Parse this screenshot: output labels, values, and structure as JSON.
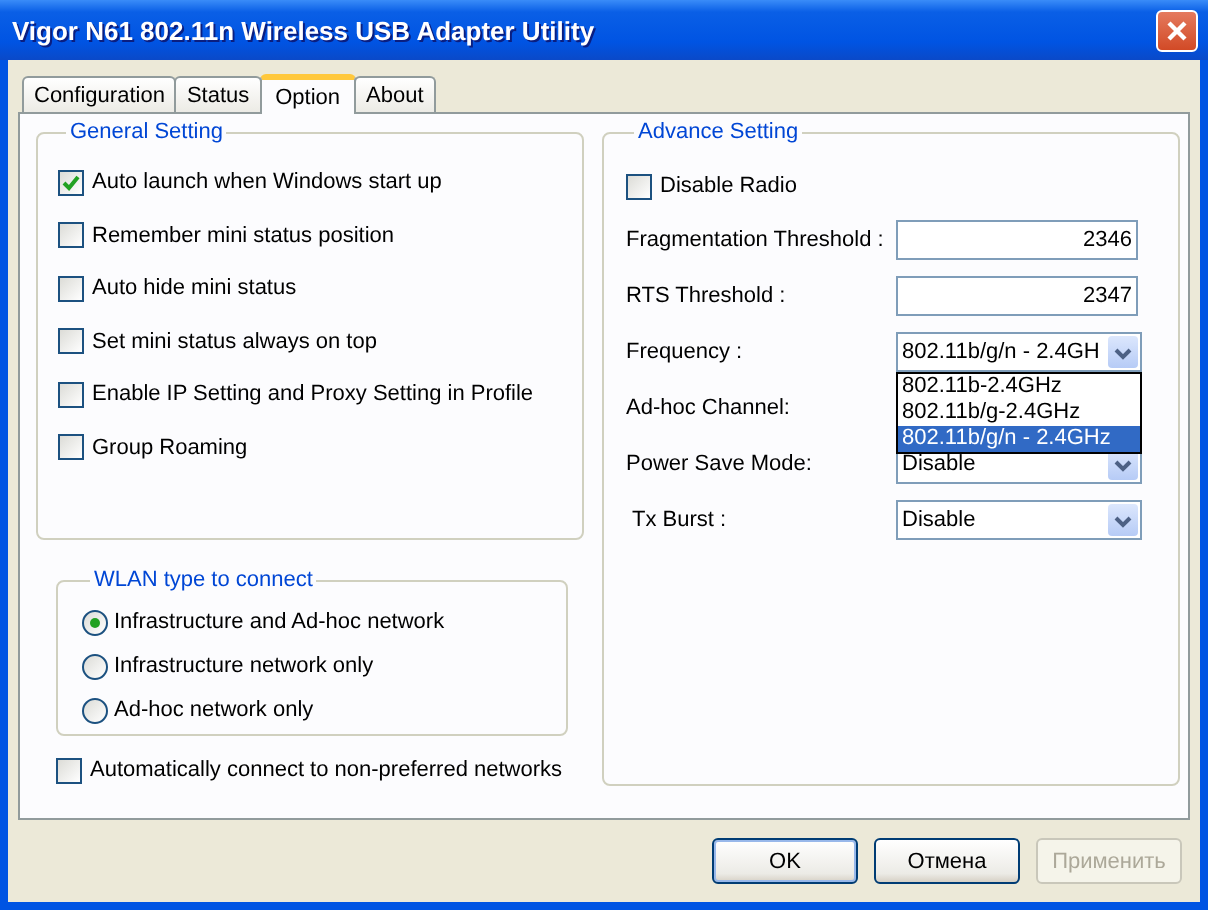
{
  "window": {
    "title": "Vigor N61 802.11n Wireless USB Adapter Utility"
  },
  "tabs": [
    {
      "label": "Configuration",
      "selected": false
    },
    {
      "label": "Status",
      "selected": false
    },
    {
      "label": "Option",
      "selected": true
    },
    {
      "label": "About",
      "selected": false
    }
  ],
  "general_setting": {
    "title": "General Setting",
    "options": [
      {
        "label": "Auto launch when Windows start up",
        "checked": true
      },
      {
        "label": "Remember mini status position",
        "checked": false
      },
      {
        "label": "Auto hide mini status",
        "checked": false
      },
      {
        "label": "Set mini status always on top",
        "checked": false
      },
      {
        "label": "Enable IP Setting and Proxy Setting in Profile",
        "checked": false
      },
      {
        "label": "Group Roaming",
        "checked": false
      }
    ]
  },
  "wlan_type": {
    "title": "WLAN type to connect",
    "options": [
      {
        "label": "Infrastructure and Ad-hoc network",
        "selected": true
      },
      {
        "label": "Infrastructure network only",
        "selected": false
      },
      {
        "label": "Ad-hoc network only",
        "selected": false
      }
    ]
  },
  "auto_connect": {
    "label": "Automatically connect to non-preferred networks",
    "checked": false
  },
  "advance_setting": {
    "title": "Advance Setting",
    "disable_radio": {
      "label": "Disable Radio",
      "checked": false
    },
    "fields": [
      {
        "kind": "text",
        "label": "Fragmentation Threshold :",
        "value": "2346"
      },
      {
        "kind": "text",
        "label": "RTS Threshold :",
        "value": "2347"
      },
      {
        "kind": "combo",
        "label": "Frequency :",
        "value": "802.11b/g/n - 2.4GH",
        "expanded": true,
        "options": [
          {
            "label": "802.11b-2.4GHz",
            "selected": false
          },
          {
            "label": "802.11b/g-2.4GHz",
            "selected": false
          },
          {
            "label": "802.11b/g/n - 2.4GHz",
            "selected": true
          }
        ]
      },
      {
        "kind": "covered",
        "label": "Ad-hoc Channel:"
      },
      {
        "kind": "combo",
        "label": "Power Save Mode:",
        "value": "Disable"
      },
      {
        "kind": "combo",
        "label": "Tx Burst :",
        "value": "Disable",
        "indent": true
      }
    ]
  },
  "buttons": [
    {
      "label": "OK",
      "disabled": false,
      "default": true
    },
    {
      "label": "Отмена",
      "disabled": false
    },
    {
      "label": "Применить",
      "disabled": true
    }
  ]
}
